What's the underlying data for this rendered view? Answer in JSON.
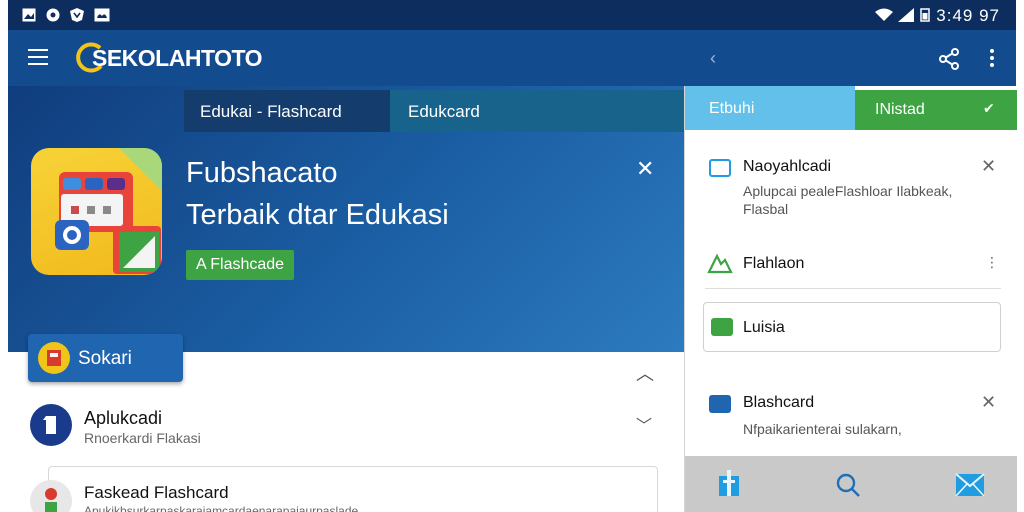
{
  "status_bar": {
    "time": "3:49 97"
  },
  "app_bar": {
    "title": "SEKOLAHTOTO"
  },
  "hero": {
    "tabs": [
      "Edukai  -  Flashcard",
      "Edukcard"
    ],
    "title_line1": "Fubshacato",
    "title_line2": "Terbaik dtar Edukasi",
    "badge": "A Flashcade"
  },
  "list": {
    "chip_label": "Sokari",
    "items": [
      {
        "title": "Aplukcadi",
        "subtitle": "Rnoerkardi Flakasi"
      },
      {
        "title": "Faskead Flashcard",
        "subtitle": "Apukikbsurkarpaskaraiamcardaenarapaiaurpaslade"
      }
    ]
  },
  "right_panel": {
    "tabs": [
      "Etbuhi",
      "INistad"
    ],
    "items": [
      {
        "title": "Naoyahlcadi",
        "subtitle": "Aplupcai pealeFlashloar Ilabkeak, Flasbal"
      },
      {
        "title": "Flahlaon"
      },
      {
        "title": "Luisia"
      },
      {
        "title": "Blashcard",
        "subtitle": "Nfpaikarienterai sulakarn,"
      }
    ]
  },
  "icons": {
    "menu": "hamburger-icon",
    "back": "back-arrow-icon",
    "share": "share-icon",
    "more": "more-vert-icon",
    "close": "close-icon",
    "check": "check-icon",
    "collapse": "chevron-up-icon",
    "expand": "chevron-down-icon",
    "nav_home": "home-icon",
    "nav_search": "search-icon",
    "nav_mail": "mail-icon"
  },
  "colors": {
    "app_bar": "#134c8e",
    "hero_gradient_start": "#103d7d",
    "accent_green": "#3ea443",
    "accent_light_blue": "#62c0ea"
  }
}
